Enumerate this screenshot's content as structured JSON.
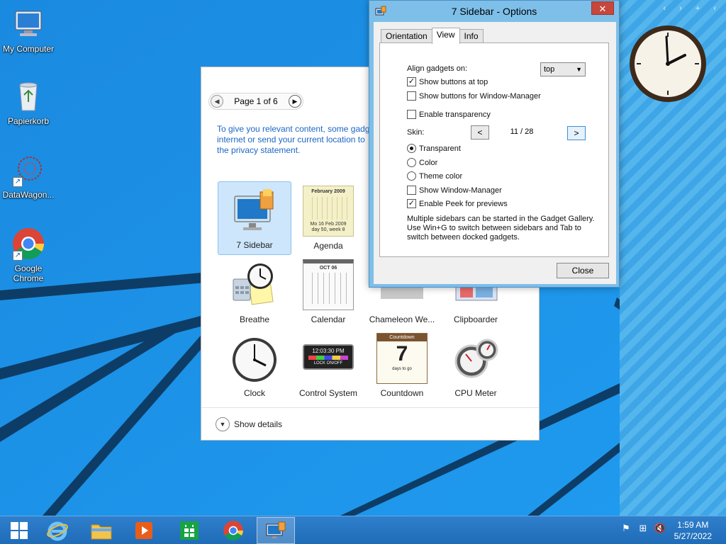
{
  "desktop": {
    "icons": [
      {
        "label": "My Computer",
        "icon": "computer-icon"
      },
      {
        "label": "Papierkorb",
        "icon": "recycle-bin-icon"
      },
      {
        "label": "DataWagon...",
        "icon": "datawagon-icon"
      },
      {
        "label": "Google Chrome",
        "icon": "chrome-icon"
      }
    ]
  },
  "gallery": {
    "page_label": "Page 1 of 6",
    "privacy_text": [
      "To give you relevant content, some gadg",
      "internet or send your current location to",
      "the privacy statement."
    ],
    "tiles": [
      {
        "label": "7 Sidebar",
        "icon": "monitor-gadget-icon",
        "selected": true
      },
      {
        "label": "Agenda",
        "icon": "agenda-calendar-icon"
      },
      {
        "label": "Breathe",
        "icon": "breathe-clock-icon"
      },
      {
        "label": "Calendar",
        "icon": "calendar-icon"
      },
      {
        "label": "Chameleon We...",
        "icon": "chameleon-weather-icon"
      },
      {
        "label": "Clipboarder",
        "icon": "clipboarder-icon"
      },
      {
        "label": "Clock",
        "icon": "clock-icon"
      },
      {
        "label": "Control System",
        "icon": "control-system-icon"
      },
      {
        "label": "Countdown",
        "icon": "countdown-icon"
      },
      {
        "label": "CPU Meter",
        "icon": "cpu-meter-icon"
      }
    ],
    "agenda_text": {
      "month": "February 2009",
      "footer1": "Mo 16 Feb 2009",
      "footer2": "day 50, week 8"
    },
    "calendar_text": {
      "month": "OCT 06"
    },
    "control_text": {
      "time": "12:03:30 PM",
      "button": "LOCK ON/OFF"
    },
    "countdown_text": {
      "header": "Countdown",
      "number": "7",
      "footer": "days to go"
    },
    "show_details": "Show details"
  },
  "options": {
    "title": "7 Sidebar - Options",
    "close_glyph": "✕",
    "tabs": [
      "Orientation",
      "View",
      "Info"
    ],
    "active_tab": "View",
    "align_label": "Align gadgets on:",
    "align_value": "top",
    "show_buttons_top": {
      "label": "Show buttons at top",
      "checked": true
    },
    "show_buttons_wm": {
      "label": "Show buttons for Window-Manager",
      "checked": false
    },
    "enable_transparency": {
      "label": "Enable transparency",
      "checked": false
    },
    "skin_label": "Skin:",
    "skin_prev": "<",
    "skin_value": "11 / 28",
    "skin_next": ">",
    "radio_transparent": {
      "label": "Transparent",
      "checked": true
    },
    "radio_color": {
      "label": "Color",
      "checked": false
    },
    "radio_theme": {
      "label": "Theme color",
      "checked": false
    },
    "show_wm": {
      "label": "Show Window-Manager",
      "checked": false
    },
    "enable_peek": {
      "label": "Enable Peek for previews",
      "checked": true
    },
    "help_text": "Multiple sidebars can be started in the Gadget Gallery. Use Win+G to switch between sidebars and Tab to switch between docked gadgets.",
    "close_button": "Close"
  },
  "taskbar": {
    "items": [
      "start-icon",
      "internet-explorer-icon",
      "file-explorer-icon",
      "media-player-icon",
      "store-icon",
      "chrome-icon",
      "gadget-gallery-icon"
    ],
    "time": "1:59 AM",
    "date": "5/27/2022"
  },
  "colors": {
    "accent": "#1c66c4",
    "taskbar": "#2574c2",
    "title_close": "#c7473c"
  }
}
